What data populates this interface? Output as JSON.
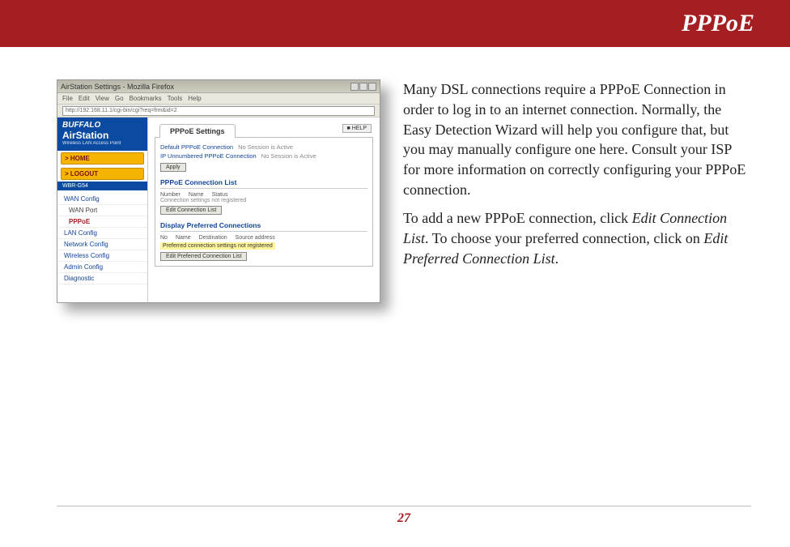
{
  "header": {
    "title": "PPPoE"
  },
  "screenshot": {
    "window_title": "AirStation Settings - Mozilla Firefox",
    "menus": [
      "File",
      "Edit",
      "View",
      "Go",
      "Bookmarks",
      "Tools",
      "Help"
    ],
    "address": "http://192.168.11.1/cgi-bin/cgi?req=frm&id=2",
    "brand_top": "BUFFALO",
    "brand_main": "AirStation",
    "brand_sub": "Wireless LAN Access Point",
    "tab_home": "> HOME",
    "tab_logout": "> LOGOUT",
    "model": "WBR-G54",
    "nav": {
      "wan": "WAN Config",
      "wan_sub": "WAN Port",
      "pppoe": "PPPoE",
      "lan": "LAN Config",
      "net": "Network Config",
      "wlan": "Wireless Config",
      "admin": "Admin Config",
      "diag": "Diagnostic"
    },
    "panel_tab": "PPPoE Settings",
    "help_btn": "■ HELP",
    "row1_label": "Default PPPoE Connection",
    "row1_val": "No Session is Active",
    "row2_label": "IP Unnumbered PPPoE Connection",
    "row2_val": "No Session is Active",
    "apply_btn": "Apply",
    "section2": "PPPoE Connection List",
    "table_head": [
      "Number",
      "Name",
      "Status"
    ],
    "note2": "Connection settings not registered",
    "btn_editlist": "Edit Connection List",
    "section3": "Display Preferred Connections",
    "table_head2": [
      "No",
      "Name",
      "Destination",
      "Source address"
    ],
    "hl_note": "Preferred connection settings not registered",
    "btn_editpref": "Edit Preferred Connection List"
  },
  "text": {
    "p1": "Many DSL connections require a PPPoE Connection in order to log in to an internet connection.  Normally, the Easy Detection Wizard will help you configure that, but you may manually configure one here.  Consult your ISP for more information on correctly configuring your PPPoE connection.",
    "p2a": "To add a new PPPoE connection, click ",
    "p2_em1": "Edit Connection List",
    "p2b": ".  To choose your preferred connection, click on ",
    "p2_em2": "Edit Preferred Connection List",
    "p2c": "."
  },
  "footer": {
    "page_no": "27"
  }
}
